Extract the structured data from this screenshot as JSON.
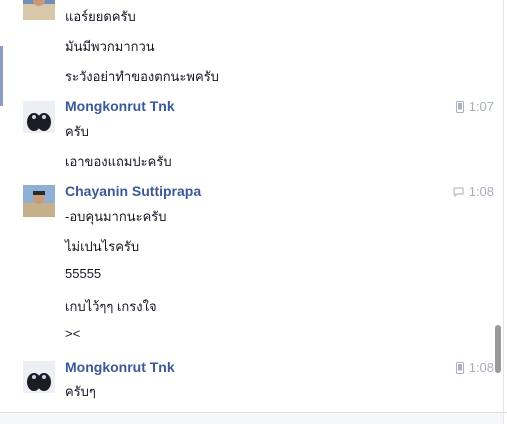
{
  "groups": [
    {
      "sender": "",
      "time": "",
      "lines": [
        "แอร์ยยดครับ",
        "มันมีพวกมากวน",
        "ระวังอย่าทำของตกนะพครับ"
      ]
    },
    {
      "sender": "Mongkonrut Tnk",
      "time": "1:07",
      "device_icon": "mobile-icon",
      "lines": [
        "ครับ",
        "เอาของแถมปะครับ"
      ]
    },
    {
      "sender": "Chayanin Suttiprapa",
      "time": "1:08",
      "device_icon": "chat-bubble-icon",
      "lines": [
        "-อบคุนมากนะครับ",
        "ไม่เปนไรครับ",
        "55555",
        "เกบไว้ๆๆ เกรงใจ",
        "><"
      ]
    },
    {
      "sender": "Mongkonrut Tnk",
      "time": "1:08",
      "device_icon": "mobile-icon",
      "lines": [
        "ครับๆ"
      ]
    }
  ],
  "colors": {
    "sender": "#3b5998",
    "text": "#141823",
    "time": "#aab0bd"
  }
}
